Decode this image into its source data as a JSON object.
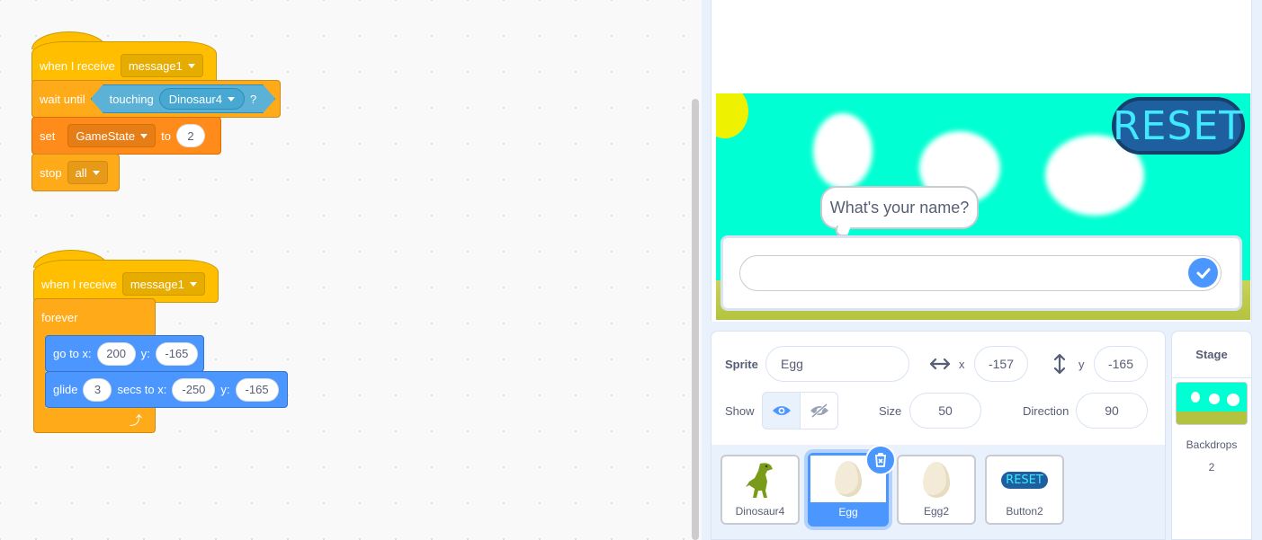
{
  "script1": {
    "hat_label": "when I receive",
    "hat_message": "message1",
    "wait_label": "wait until",
    "touching_label": "touching",
    "touching_target": "Dinosaur4",
    "question": "?",
    "set_label": "set",
    "set_var": "GameState",
    "to_label": "to",
    "set_value": "2",
    "stop_label": "stop",
    "stop_option": "all"
  },
  "script2": {
    "hat_label": "when I receive",
    "hat_message": "message1",
    "forever_label": "forever",
    "goto_label": "go to x:",
    "goto_x": "200",
    "goto_y_label": "y:",
    "goto_y": "-165",
    "glide_label": "glide",
    "glide_secs": "3",
    "glide_secs_label": "secs to x:",
    "glide_x": "-250",
    "glide_y_label": "y:",
    "glide_y": "-165",
    "loop_arrow": "⤴"
  },
  "stage": {
    "reset_text": "RESET",
    "bubble_text": "What's your name?",
    "answer_value": "",
    "colors": {
      "sky": "#00ffd2",
      "sun": "#eef200",
      "ground": "#b4c33f",
      "reset": "#1e5fa0"
    }
  },
  "sprite_info": {
    "sprite_label": "Sprite",
    "sprite_name": "Egg",
    "x_label": "x",
    "x_value": "-157",
    "y_label": "y",
    "y_value": "-165",
    "show_label": "Show",
    "size_label": "Size",
    "size_value": "50",
    "direction_label": "Direction",
    "direction_value": "90"
  },
  "sprites": [
    {
      "name": "Dinosaur4",
      "icon": "dinosaur-icon"
    },
    {
      "name": "Egg",
      "icon": "egg-icon",
      "selected": true
    },
    {
      "name": "Egg2",
      "icon": "egg-icon"
    },
    {
      "name": "Button2",
      "icon": "reset-button-icon",
      "thumb_text": "RESET"
    }
  ],
  "stage_pane": {
    "title": "Stage",
    "backdrops_label": "Backdrops",
    "backdrops_count": "2"
  }
}
